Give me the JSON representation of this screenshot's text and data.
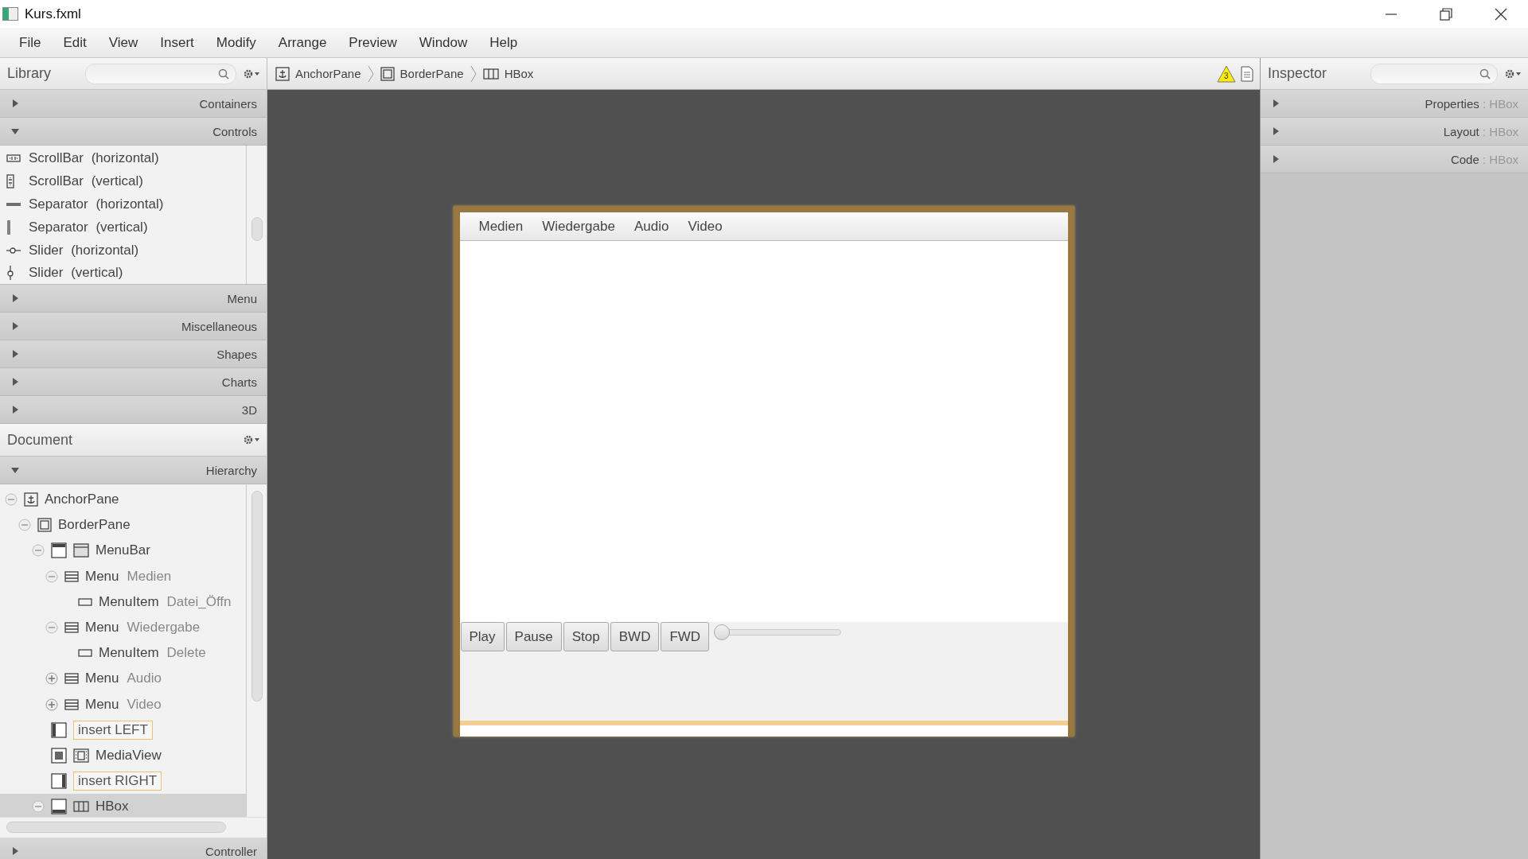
{
  "window": {
    "title": "Kurs.fxml"
  },
  "menu": [
    "File",
    "Edit",
    "View",
    "Insert",
    "Modify",
    "Arrange",
    "Preview",
    "Window",
    "Help"
  ],
  "library": {
    "title": "Library",
    "sections": [
      {
        "label": "Containers",
        "expanded": false
      },
      {
        "label": "Controls",
        "expanded": true,
        "items": [
          {
            "label": "ScrollBar (horizontal)",
            "kind": "scrollbar-h"
          },
          {
            "label": "ScrollBar (vertical)",
            "kind": "scrollbar-v"
          },
          {
            "label": "Separator (horizontal)",
            "kind": "separator-h"
          },
          {
            "label": "Separator (vertical)",
            "kind": "separator-v"
          },
          {
            "label": "Slider (horizontal)",
            "kind": "slider-h"
          },
          {
            "label": "Slider (vertical)",
            "kind": "slider-v"
          }
        ]
      },
      {
        "label": "Menu",
        "expanded": false
      },
      {
        "label": "Miscellaneous",
        "expanded": false
      },
      {
        "label": "Shapes",
        "expanded": false
      },
      {
        "label": "Charts",
        "expanded": false
      },
      {
        "label": "3D",
        "expanded": false
      }
    ]
  },
  "document": {
    "title": "Document",
    "hierarchy": {
      "label": "Hierarchy",
      "expanded": true,
      "tree": [
        {
          "type": "AnchorPane",
          "kind": "anchorpane",
          "expanded": true,
          "selected": false,
          "children": [
            {
              "type": "BorderPane",
              "kind": "borderpane",
              "expanded": true,
              "selected": false,
              "children": [
                {
                  "type": "MenuBar",
                  "kind": "menubar",
                  "expanded": true,
                  "selected": false,
                  "children": [
                    {
                      "type": "Menu",
                      "name": "Medien",
                      "kind": "menu",
                      "expanded": true,
                      "selected": false,
                      "children": [
                        {
                          "type": "MenuItem",
                          "name": "Datei_Öffn",
                          "kind": "menuitem",
                          "selected": false
                        }
                      ]
                    },
                    {
                      "type": "Menu",
                      "name": "Wiedergabe",
                      "kind": "menu",
                      "expanded": true,
                      "selected": false,
                      "children": [
                        {
                          "type": "MenuItem",
                          "name": "Delete",
                          "kind": "menuitem",
                          "selected": false
                        }
                      ]
                    },
                    {
                      "type": "Menu",
                      "name": "Audio",
                      "kind": "menu",
                      "expanded": false,
                      "selected": false
                    },
                    {
                      "type": "Menu",
                      "name": "Video",
                      "kind": "menu",
                      "expanded": false,
                      "selected": false
                    }
                  ]
                },
                {
                  "type": "insert LEFT",
                  "kind": "insert",
                  "selected": false
                },
                {
                  "type": "MediaView",
                  "kind": "mediaview",
                  "selected": false
                },
                {
                  "type": "insert RIGHT",
                  "kind": "insert",
                  "selected": false
                },
                {
                  "type": "HBox",
                  "kind": "hbox",
                  "expanded": true,
                  "selected": true
                }
              ]
            }
          ]
        }
      ]
    },
    "controller": {
      "label": "Controller",
      "expanded": false
    }
  },
  "breadcrumbs": [
    {
      "label": "AnchorPane",
      "kind": "anchorpane"
    },
    {
      "label": "BorderPane",
      "kind": "borderpane"
    },
    {
      "label": "HBox",
      "kind": "hbox"
    }
  ],
  "warnings": {
    "count": "3"
  },
  "inspector": {
    "title": "Inspector",
    "sections": [
      {
        "label": "Properties",
        "separator": ":",
        "target": "HBox",
        "expanded": false
      },
      {
        "label": "Layout",
        "separator": ":",
        "target": "HBox",
        "expanded": false
      },
      {
        "label": "Code",
        "separator": ":",
        "target": "HBox",
        "expanded": false
      }
    ]
  },
  "preview": {
    "menus": [
      "Medien",
      "Wiedergabe",
      "Audio",
      "Video"
    ],
    "buttons": [
      "Play",
      "Pause",
      "Stop",
      "BWD",
      "FWD"
    ],
    "slider": {
      "level": 0
    }
  }
}
